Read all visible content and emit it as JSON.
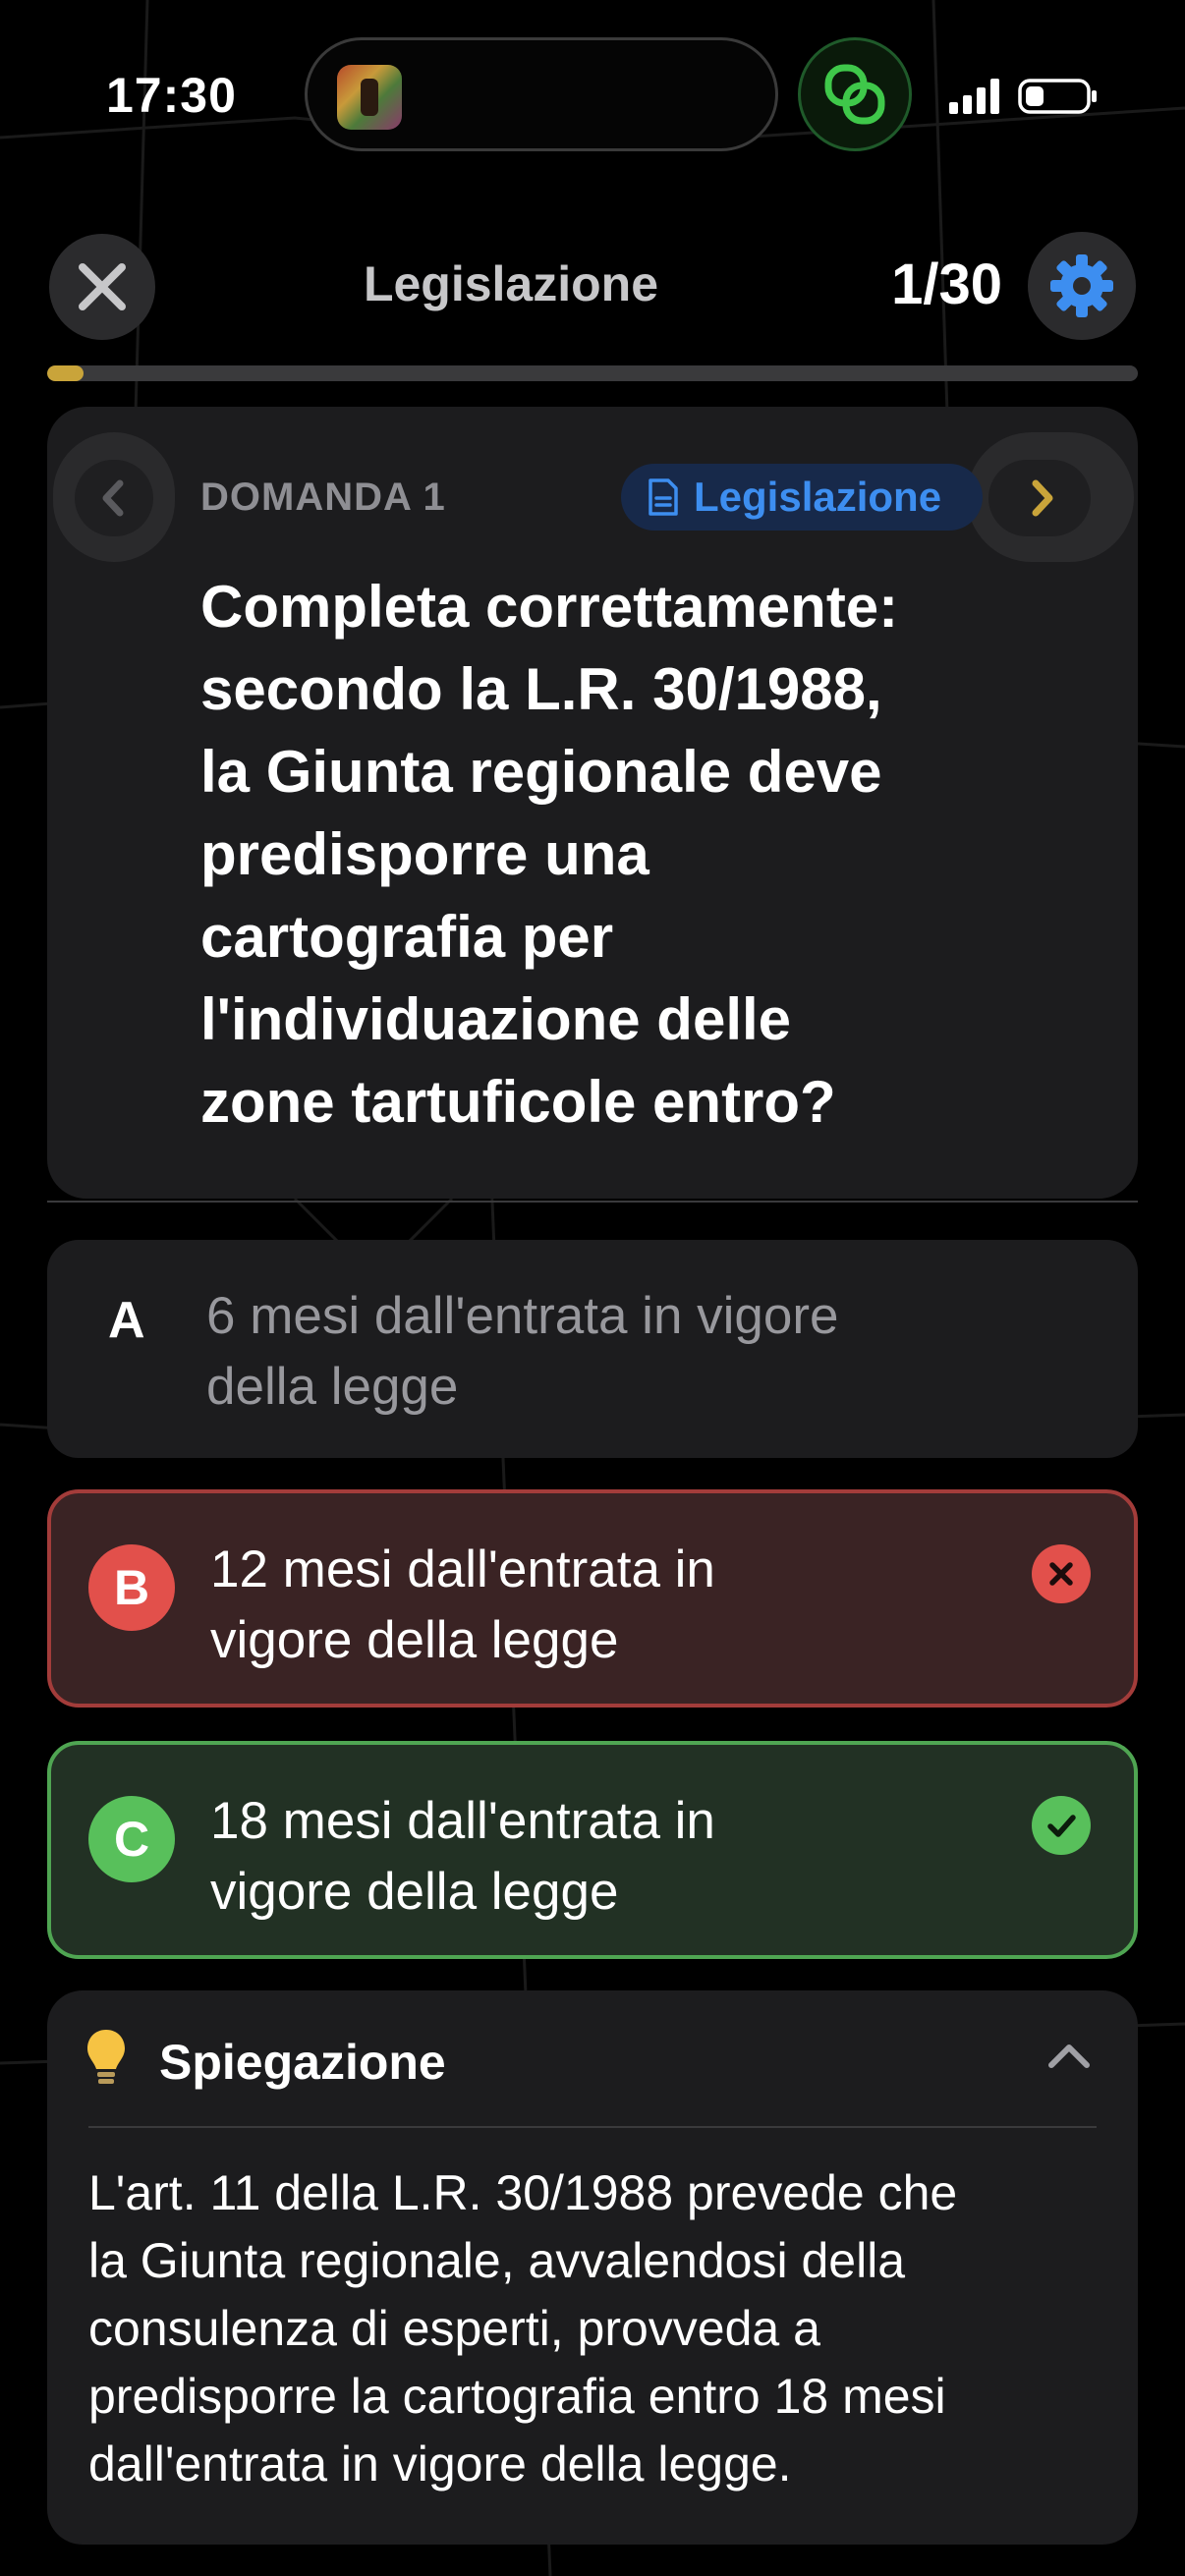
{
  "status_bar": {
    "time": "17:30",
    "app_icon": "tarot-app-icon",
    "link_icon": "link-rings-icon",
    "signal_icon": "cellular-signal-icon",
    "battery_icon": "battery-icon",
    "accent": "#3fc84a"
  },
  "header": {
    "title": "Legislazione",
    "counter": "1/30",
    "progress": 0.0333,
    "progress_color": "#c9a43a",
    "close_icon": "close-icon",
    "settings_icon": "gear-icon",
    "settings_color": "#3d8ef0"
  },
  "question": {
    "label": "DOMANDA 1",
    "category": "Legislazione",
    "category_icon": "document-icon",
    "lines": [
      "Completa correttamente:",
      "secondo la L.R. 30/1988,",
      "la Giunta regionale deve",
      "predisporre una",
      "cartografia per",
      "l'individuazione delle",
      "zone tartuficole entro?"
    ]
  },
  "answers": [
    {
      "letter": "A",
      "line1": "6 mesi dall'entrata in vigore",
      "line2": "della legge",
      "state": "neutral"
    },
    {
      "letter": "B",
      "line1": "12 mesi dall'entrata in",
      "line2": "vigore della legge",
      "state": "wrong",
      "color": "#e2504b"
    },
    {
      "letter": "C",
      "line1": "18 mesi dall'entrata in",
      "line2": "vigore della legge",
      "state": "correct",
      "color": "#58c05b"
    }
  ],
  "explanation": {
    "title": "Spiegazione",
    "icon": "lightbulb-icon",
    "lines": [
      "L'art. 11 della L.R. 30/1988 prevede che",
      "la Giunta regionale, avvalendosi della",
      "consulenza di esperti, provveda a",
      "predisporre la cartografia entro 18 mesi",
      "dall'entrata in vigore della legge."
    ]
  }
}
